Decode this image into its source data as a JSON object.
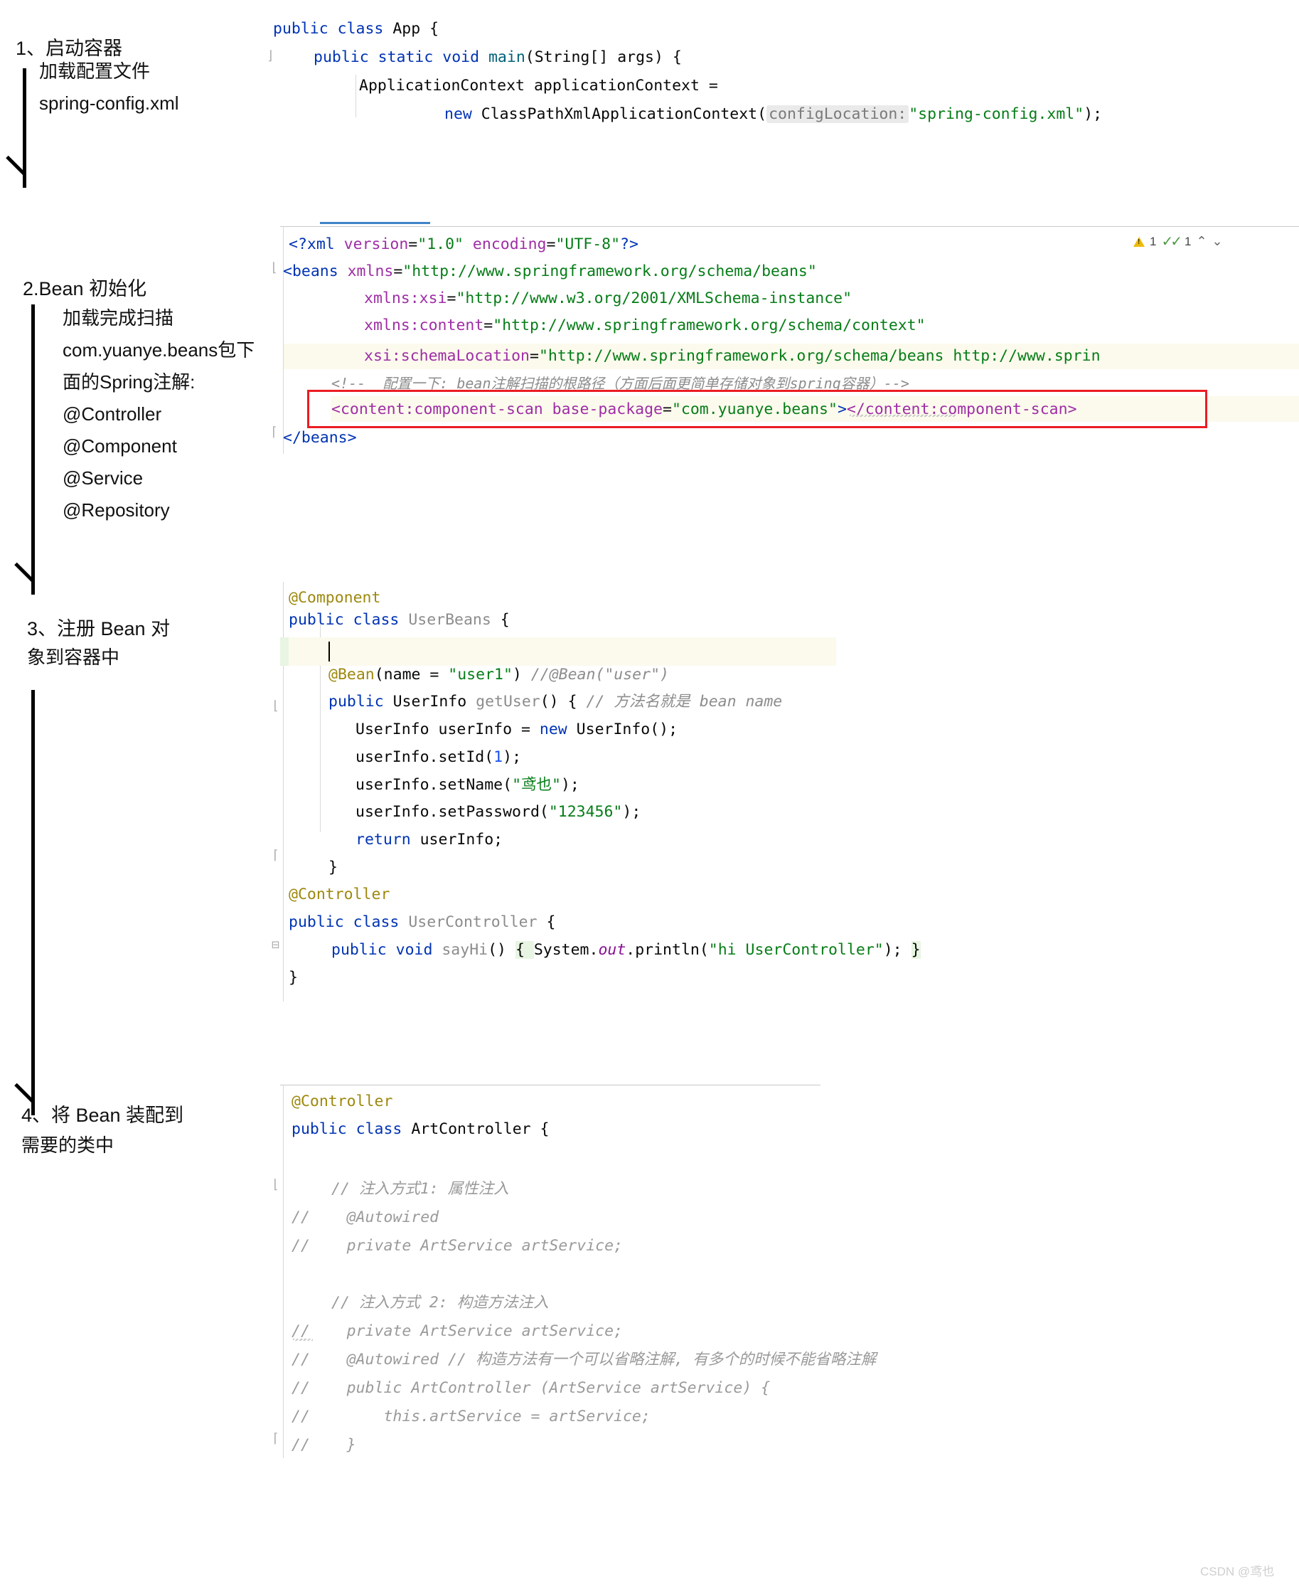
{
  "steps": [
    {
      "id": "step1",
      "title": "1、启动容器",
      "lines": [
        "加载配置文件",
        "spring-config.xml"
      ]
    },
    {
      "id": "step2",
      "title": "2.Bean 初始化",
      "lines": [
        "加载完成扫描",
        "com.yuanye.beans包下",
        "面的Spring注解:",
        "@Controller",
        "@Component",
        "@Service",
        "@Repository"
      ]
    },
    {
      "id": "step3",
      "title": "3、注册 Bean 对",
      "lines": [
        "象到容器中"
      ]
    },
    {
      "id": "step4",
      "title": "4、将 Bean 装配到",
      "lines": [
        "需要的类中"
      ]
    }
  ],
  "code_app": {
    "line1_kw1": "public",
    "line1_kw2": "class",
    "line1_cls": "App",
    "line1_brace": "{",
    "line2": "public static void main(String[] args) {",
    "line2_kw1": "public",
    "line2_kw2": "static",
    "line2_kw3": "void",
    "line2_mth": "main",
    "line2_rest": "(String[] args) {",
    "line3": "ApplicationContext applicationContext =",
    "line4_new": "new",
    "line4_cls": " ClassPathXmlApplicationContext(",
    "line4_hint": "configLocation:",
    "line4_str": "\"spring-config.xml\"",
    "line4_end": ");"
  },
  "code_xml": {
    "inspection": {
      "warning_count": "1",
      "ok_count": "1",
      "up": "⌃",
      "down": "⌄"
    },
    "l1": "<?xml version=\"1.0\" encoding=\"UTF-8\"?>",
    "l1_tag": "<?xml",
    "l1_a1": " version",
    "l1_v1": "\"1.0\"",
    "l1_a2": " encoding",
    "l1_v2": "\"UTF-8\"",
    "l1_end": "?>",
    "l2_tag": "<beans",
    "l2_attr": " xmlns",
    "l2_val": "\"http://www.springframework.org/schema/beans\"",
    "l3_attr": "xmlns:xsi",
    "l3_val": "\"http://www.w3.org/2001/XMLSchema-instance\"",
    "l4_attr": "xmlns:content",
    "l4_val": "\"http://www.springframework.org/schema/context\"",
    "l5_attr": "xsi:schemaLocation",
    "l5_val": "\"http://www.springframework.org/schema/beans http://www.sprin",
    "l6_comment": "<!--  配置一下: bean注解扫描的根路径（方面后面更简单存储对象到spring容器）-->",
    "l7_open": "<content:component-scan",
    "l7_attr": " base-package",
    "l7_val": "\"com.yuanye.beans\"",
    "l7_gt": ">",
    "l7_close": "</content:component-scan>",
    "l8": "</beans>"
  },
  "code_beans": {
    "l1": "@Component",
    "l2_kw1": "public",
    "l2_kw2": "class",
    "l2_cls": "UserBeans",
    "l2_brace": "{",
    "l4_ann": "@Bean",
    "l4_p1": "(name = ",
    "l4_str": "\"user1\"",
    "l4_p2": ") ",
    "l4_cmt": "//@Bean(\"user\")",
    "l5_kw": "public",
    "l5_type": " UserInfo ",
    "l5_mth": "getUser",
    "l5_rest": "() { ",
    "l5_cmt": "// 方法名就是 bean name",
    "l6_a": "UserInfo userInfo = ",
    "l6_new": "new",
    "l6_b": " UserInfo();",
    "l7_a": "userInfo.setId(",
    "l7_num": "1",
    "l7_b": ");",
    "l8_a": "userInfo.setName(",
    "l8_str": "\"鸢也\"",
    "l8_b": ");",
    "l9_a": "userInfo.setPassword(",
    "l9_str": "\"123456\"",
    "l9_b": ");",
    "l10_kw": "return",
    "l10_rest": " userInfo;",
    "l11": "}",
    "l12": "@Controller",
    "l13_kw1": "public",
    "l13_kw2": "class",
    "l13_cls": "UserController",
    "l13_brace": "{",
    "l14_kw1": "public",
    "l14_kw2": "void",
    "l14_mth": "sayHi",
    "l14_a": "() ",
    "l14_b": "{ ",
    "l14_sys": "System.",
    "l14_out": "out",
    "l14_c": ".println(",
    "l14_str": "\"hi UserController\"",
    "l14_d": "); ",
    "l14_e": "}",
    "l15": "}"
  },
  "code_art": {
    "l1": "@Controller",
    "l2_kw1": "public",
    "l2_kw2": "class",
    "l2_cls": "ArtController",
    "l2_brace": "{",
    "l3": "// 注入方式1: 属性注入",
    "l4": "//    @Autowired",
    "l5": "//    private ArtService artService;",
    "l6": "// 注入方式 2: 构造方法注入",
    "l7": "//    private ArtService artService;",
    "l8": "//    @Autowired // 构造方法有一个可以省略注解, 有多个的时候不能省略注解",
    "l9": "//    public ArtController (ArtService artService) {",
    "l10": "//        this.artService = artService;",
    "l11": "//    }"
  },
  "watermark": "CSDN @鸢也",
  "colors": {
    "keyword": "#0033b3",
    "string": "#067d17",
    "annotation": "#9e880d",
    "comment": "#8c8c8c",
    "xml_attr": "#9e2ea5",
    "highlight_bg": "#fcfaed",
    "red_box": "#ec1c24",
    "tab_underline": "#4083c9"
  }
}
